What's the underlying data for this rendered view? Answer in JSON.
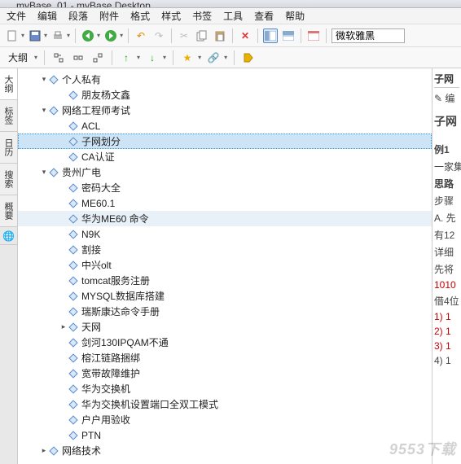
{
  "title": "myBase_01 - myBase Desktop",
  "menu": [
    "文件",
    "编辑",
    "段落",
    "附件",
    "格式",
    "样式",
    "书签",
    "工具",
    "查看",
    "帮助"
  ],
  "fontbox": "微软雅黑",
  "outline_label": "大纲",
  "sidetabs": [
    "大纲",
    "标签",
    "日历",
    "搜索",
    "概要"
  ],
  "tree": [
    {
      "d": 0,
      "a": "▾",
      "t": "个人私有"
    },
    {
      "d": 1,
      "a": "",
      "t": "朋友杨文鑫"
    },
    {
      "d": 0,
      "a": "▾",
      "t": "网络工程师考试"
    },
    {
      "d": 1,
      "a": "",
      "t": "ACL"
    },
    {
      "d": 1,
      "a": "",
      "t": "子网划分",
      "sel": true
    },
    {
      "d": 1,
      "a": "",
      "t": "CA认证"
    },
    {
      "d": 0,
      "a": "▾",
      "t": "贵州广电"
    },
    {
      "d": 1,
      "a": "",
      "t": "密码大全"
    },
    {
      "d": 1,
      "a": "",
      "t": "ME60.1"
    },
    {
      "d": 1,
      "a": "",
      "t": "华为ME60 命令",
      "hov": true
    },
    {
      "d": 1,
      "a": "",
      "t": "N9K"
    },
    {
      "d": 1,
      "a": "",
      "t": "割接"
    },
    {
      "d": 1,
      "a": "",
      "t": "中兴olt"
    },
    {
      "d": 1,
      "a": "",
      "t": "tomcat服务注册"
    },
    {
      "d": 1,
      "a": "",
      "t": "MYSQL数据库搭建"
    },
    {
      "d": 1,
      "a": "",
      "t": "瑞斯康达命令手册"
    },
    {
      "d": 1,
      "a": "▸",
      "t": "天网"
    },
    {
      "d": 1,
      "a": "",
      "t": "剑河130IPQAM不通"
    },
    {
      "d": 1,
      "a": "",
      "t": "榕江链路捆绑"
    },
    {
      "d": 1,
      "a": "",
      "t": "宽带故障维护"
    },
    {
      "d": 1,
      "a": "",
      "t": "华为交换机"
    },
    {
      "d": 1,
      "a": "",
      "t": "华为交换机设置端口全双工模式"
    },
    {
      "d": 1,
      "a": "",
      "t": "户户用验收"
    },
    {
      "d": 1,
      "a": "",
      "t": "PTN"
    },
    {
      "d": 0,
      "a": "▸",
      "t": "网络技术"
    }
  ],
  "right": {
    "header": "子网",
    "edit": "✎ 编",
    "title2": "子网",
    "ex": "例1",
    "l1": "一家集",
    "l2": "思路",
    "l3": "步骤",
    "l4": "A. 先",
    "l5": "有12",
    "l6": "详细",
    "l7": "先将",
    "l8": "1010",
    "l9": "借4位",
    "l10": "1)  1",
    "l11": "2)  1",
    "l12": "3)  1",
    "l13": "4)  1"
  },
  "watermark": "9553下载"
}
